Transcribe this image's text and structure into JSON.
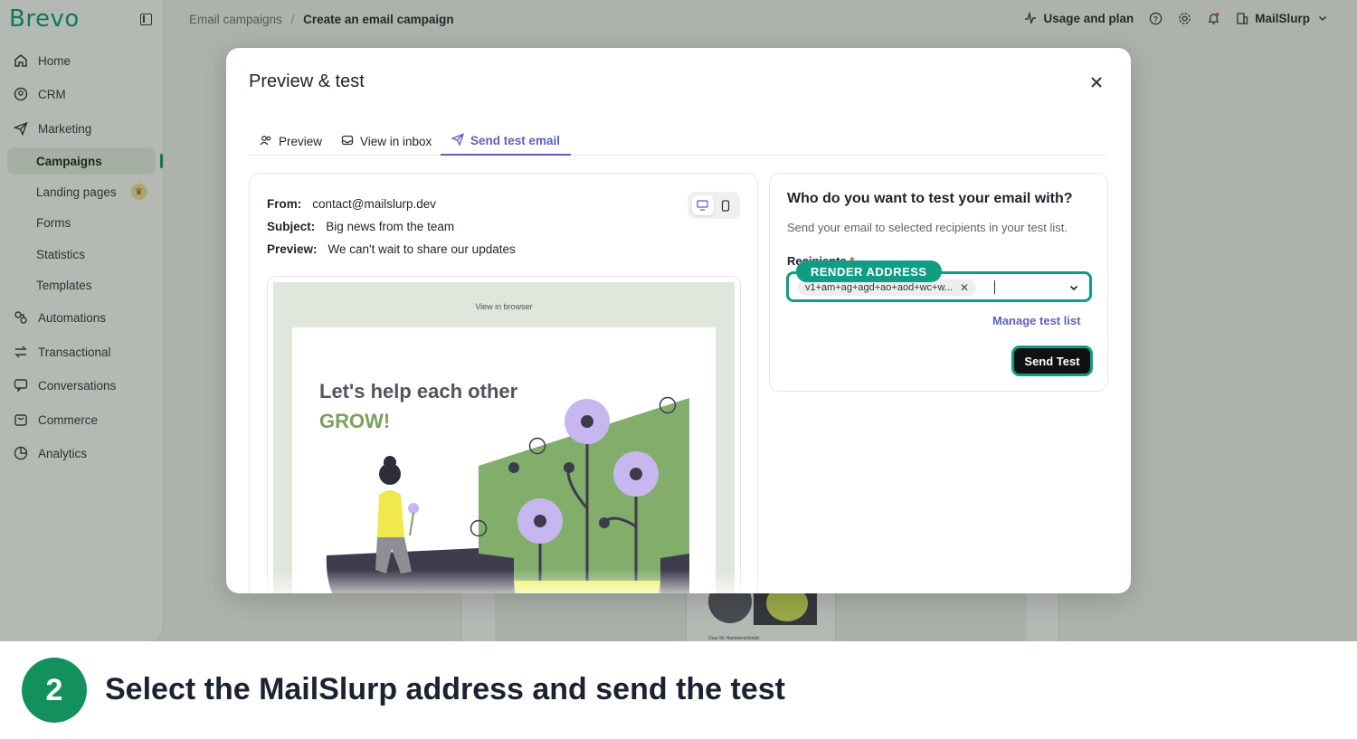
{
  "app": {
    "brand": "Brevo",
    "nav": [
      {
        "label": "Home",
        "icon": "home-icon"
      },
      {
        "label": "CRM",
        "icon": "crm-icon"
      },
      {
        "label": "Marketing",
        "icon": "send-icon"
      },
      {
        "label": "Campaigns",
        "sub": true,
        "active": true
      },
      {
        "label": "Landing pages",
        "sub": true
      },
      {
        "label": "Forms",
        "sub": true
      },
      {
        "label": "Statistics",
        "sub": true
      },
      {
        "label": "Templates",
        "sub": true
      },
      {
        "label": "Automations",
        "icon": "automations-icon"
      },
      {
        "label": "Transactional",
        "icon": "transactional-icon"
      },
      {
        "label": "Conversations",
        "icon": "chat-icon"
      },
      {
        "label": "Commerce",
        "icon": "commerce-icon"
      },
      {
        "label": "Analytics",
        "icon": "analytics-icon"
      }
    ],
    "breadcrumb": {
      "parent": "Email campaigns",
      "separator": "/",
      "current": "Create an email campaign"
    },
    "topbar": {
      "usage": "Usage and plan",
      "account": "MailSlurp"
    },
    "background_thumb_text": "Dear Mr Hammerschmidt"
  },
  "modal": {
    "title": "Preview & test",
    "tabs": [
      {
        "label": "Preview",
        "icon": "users-icon"
      },
      {
        "label": "View in inbox",
        "icon": "inbox-icon"
      },
      {
        "label": "Send test email",
        "icon": "send-icon",
        "active": true
      }
    ],
    "meta": {
      "from_label": "From:",
      "from_value": "contact@mailslurp.dev",
      "subject_label": "Subject:",
      "subject_value": "Big news from the team",
      "preview_label": "Preview:",
      "preview_value": "We can't wait to share our updates"
    },
    "email": {
      "view_in_browser": "View in browser",
      "headline": "Let's help each other",
      "headline_accent": "GROW!"
    },
    "test": {
      "title": "Who do you want to test your email with?",
      "subtitle": "Send your email to selected recipients in your test list.",
      "recipients_label": "Recipients",
      "required_mark": "*",
      "chip_value": "v1+am+ag+agd+ao+aod+wc+w...",
      "callout": "RENDER ADDRESS",
      "manage_link": "Manage test list",
      "send_button": "Send Test"
    }
  },
  "caption": {
    "step": "2",
    "text": "Select the MailSlurp address and send the test"
  },
  "colors": {
    "accent": "#0f9d84",
    "brand": "#0b996e",
    "link": "#5b5fc7",
    "step": "#12915f"
  }
}
